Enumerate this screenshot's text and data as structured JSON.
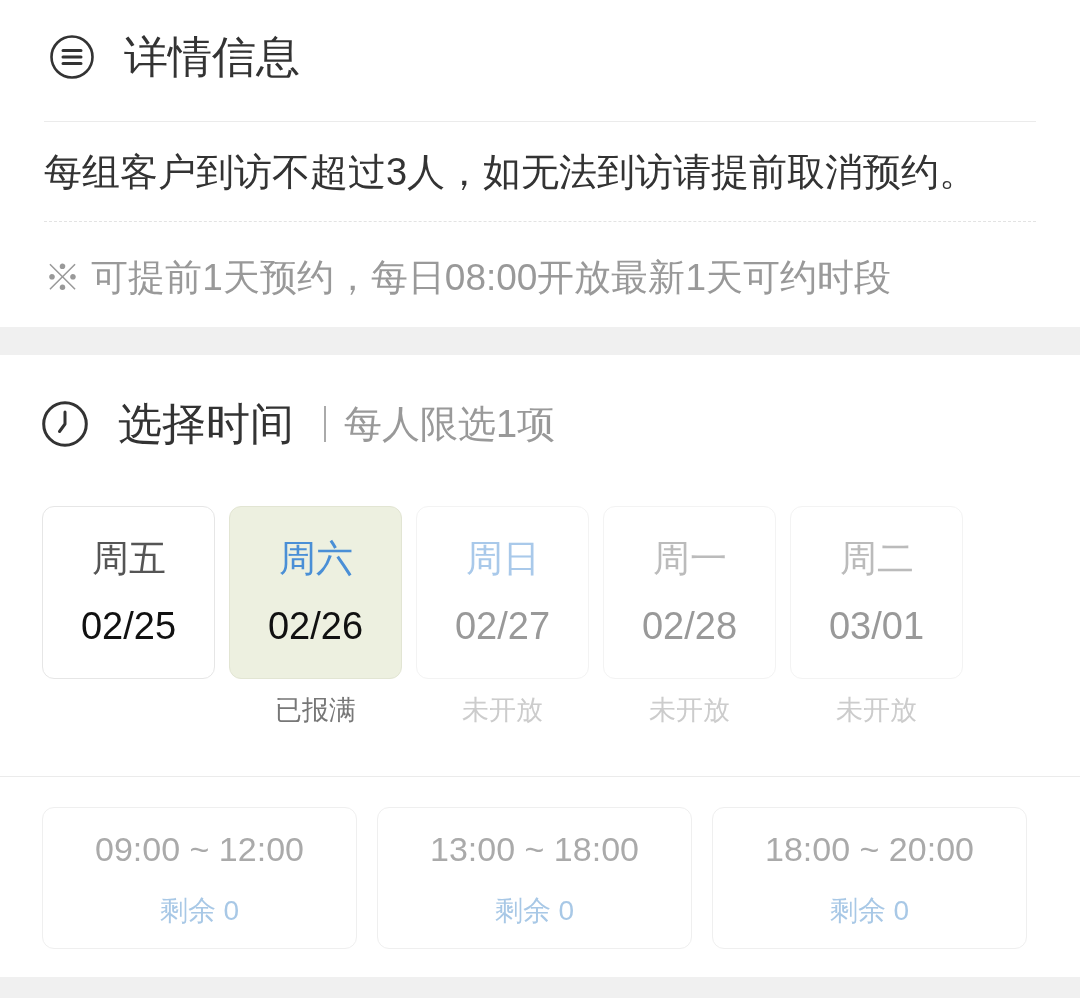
{
  "details": {
    "title": "详情信息",
    "rule": "每组客户到访不超过3人，如无法到访请提前取消预约。",
    "note": "※ 可提前1天预约，每日08:00开放最新1天可约时段"
  },
  "time_picker": {
    "title": "选择时间",
    "hint": "每人限选1项",
    "dates": [
      {
        "weekday": "周五",
        "date": "02/25",
        "selected": false,
        "weekend": false,
        "disabled": false
      },
      {
        "weekday": "周六",
        "date": "02/26",
        "status": "已报满",
        "selected": true,
        "weekend": true,
        "disabled": false
      },
      {
        "weekday": "周日",
        "date": "02/27",
        "status": "未开放",
        "selected": false,
        "weekend": true,
        "disabled": true
      },
      {
        "weekday": "周一",
        "date": "02/28",
        "status": "未开放",
        "selected": false,
        "weekend": false,
        "disabled": true
      },
      {
        "weekday": "周二",
        "date": "03/01",
        "status": "未开放",
        "selected": false,
        "weekend": false,
        "disabled": true
      }
    ],
    "slots": [
      {
        "time": "09:00 ~ 12:00",
        "remaining": "剩余 0",
        "disabled": true
      },
      {
        "time": "13:00 ~ 18:00",
        "remaining": "剩余 0",
        "disabled": true
      },
      {
        "time": "18:00 ~ 20:00",
        "remaining": "剩余 0",
        "disabled": true
      }
    ]
  }
}
